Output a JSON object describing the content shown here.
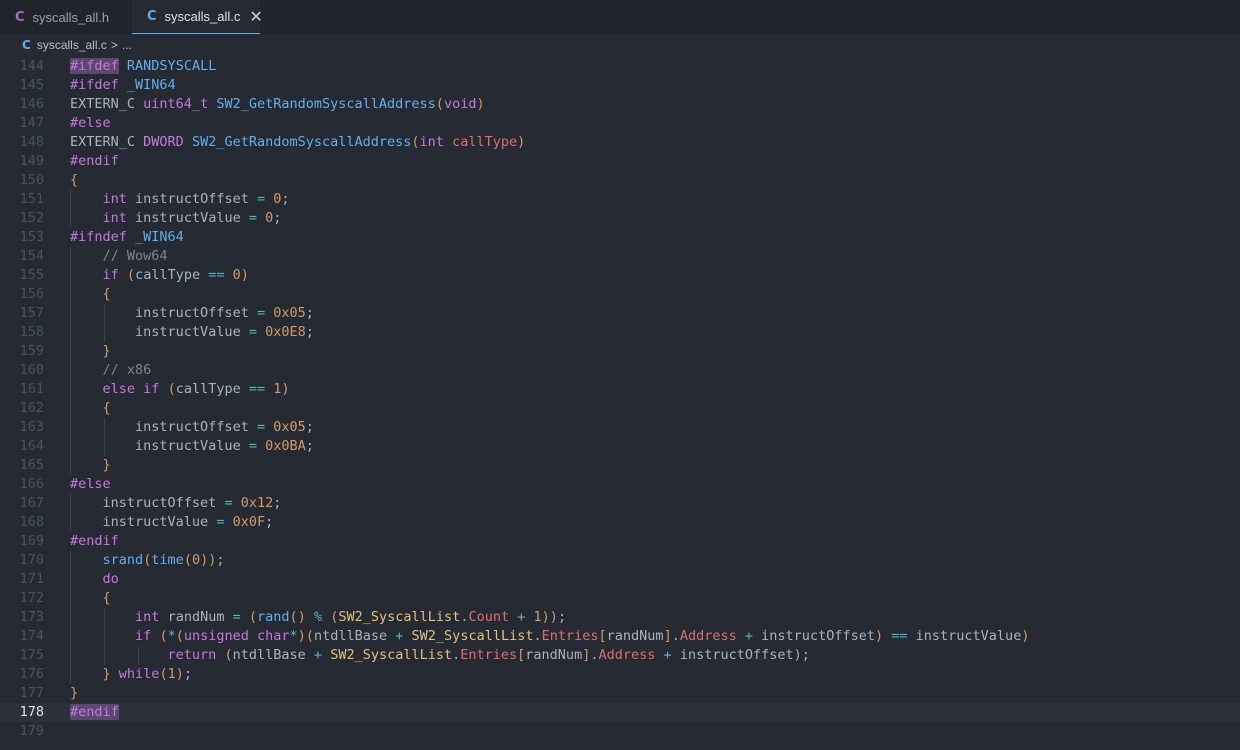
{
  "tabs": [
    {
      "icon": "C",
      "label": "syscalls_all.h",
      "active": false
    },
    {
      "icon": "C",
      "label": "syscalls_all.c",
      "active": true,
      "close": "✕"
    }
  ],
  "breadcrumb": {
    "icon": "C",
    "file": "syscalls_all.c",
    "separator": ">",
    "rest": "..."
  },
  "editor": {
    "current_line": 178,
    "lines": [
      {
        "n": "144",
        "t": "#ifdef RANDSYSCALL"
      },
      {
        "n": "145",
        "t": "#ifdef _WIN64"
      },
      {
        "n": "146",
        "t": "EXTERN_C uint64_t SW2_GetRandomSyscallAddress(void)"
      },
      {
        "n": "147",
        "t": "#else"
      },
      {
        "n": "148",
        "t": "EXTERN_C DWORD SW2_GetRandomSyscallAddress(int callType)"
      },
      {
        "n": "149",
        "t": "#endif"
      },
      {
        "n": "150",
        "t": "{"
      },
      {
        "n": "151",
        "t": "    int instructOffset = 0;"
      },
      {
        "n": "152",
        "t": "    int instructValue = 0;"
      },
      {
        "n": "153",
        "t": "#ifndef _WIN64"
      },
      {
        "n": "154",
        "t": "    // Wow64"
      },
      {
        "n": "155",
        "t": "    if (callType == 0)"
      },
      {
        "n": "156",
        "t": "    {"
      },
      {
        "n": "157",
        "t": "        instructOffset = 0x05;"
      },
      {
        "n": "158",
        "t": "        instructValue = 0x0E8;"
      },
      {
        "n": "159",
        "t": "    }"
      },
      {
        "n": "160",
        "t": "    // x86"
      },
      {
        "n": "161",
        "t": "    else if (callType == 1)"
      },
      {
        "n": "162",
        "t": "    {"
      },
      {
        "n": "163",
        "t": "        instructOffset = 0x05;"
      },
      {
        "n": "164",
        "t": "        instructValue = 0x0BA;"
      },
      {
        "n": "165",
        "t": "    }"
      },
      {
        "n": "166",
        "t": "#else"
      },
      {
        "n": "167",
        "t": "    instructOffset = 0x12;"
      },
      {
        "n": "168",
        "t": "    instructValue = 0x0F;"
      },
      {
        "n": "169",
        "t": "#endif"
      },
      {
        "n": "170",
        "t": "    srand(time(0));"
      },
      {
        "n": "171",
        "t": "    do"
      },
      {
        "n": "172",
        "t": "    {"
      },
      {
        "n": "173",
        "t": "        int randNum = (rand() % (SW2_SyscallList.Count + 1));"
      },
      {
        "n": "174",
        "t": "        if (*(unsigned char*)(ntdllBase + SW2_SyscallList.Entries[randNum].Address + instructOffset) == instructValue)"
      },
      {
        "n": "175",
        "t": "            return (ntdllBase + SW2_SyscallList.Entries[randNum].Address + instructOffset);"
      },
      {
        "n": "176",
        "t": "    } while(1);"
      },
      {
        "n": "177",
        "t": "}"
      },
      {
        "n": "178",
        "t": "#endif"
      },
      {
        "n": "179",
        "t": ""
      }
    ]
  }
}
